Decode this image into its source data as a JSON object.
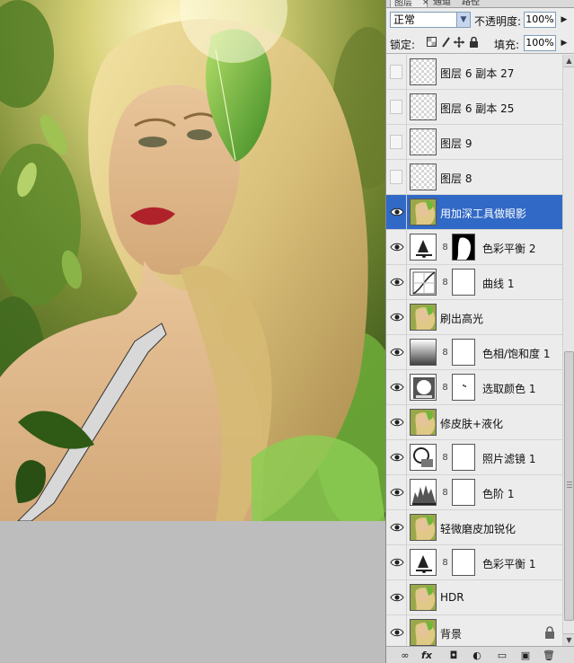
{
  "panel": {
    "tabs": [
      {
        "label": "图层",
        "active": true
      },
      {
        "label": "通道",
        "active": false
      },
      {
        "label": "路径",
        "active": false
      }
    ],
    "tab_close": "×",
    "blend_mode": "正常",
    "opacity_label": "不透明度:",
    "opacity_value": "100%",
    "lock_label": "锁定:",
    "fill_label": "填充:",
    "fill_value": "100%",
    "dropdown_arrow": "▼",
    "spin_arrow": "▶"
  },
  "layers": [
    {
      "name": "图层 6 副本 27",
      "visible": false,
      "type": "empty",
      "selected": false
    },
    {
      "name": "图层 6 副本 25",
      "visible": false,
      "type": "empty",
      "selected": false
    },
    {
      "name": "图层 9",
      "visible": false,
      "type": "empty",
      "selected": false
    },
    {
      "name": "图层 8",
      "visible": false,
      "type": "empty-soft",
      "selected": false
    },
    {
      "name": "用加深工具做眼影",
      "visible": true,
      "type": "photo",
      "selected": true
    },
    {
      "name": "色彩平衡 2",
      "visible": true,
      "type": "color-balance",
      "mask": "figure",
      "selected": false
    },
    {
      "name": "曲线 1",
      "visible": true,
      "type": "curves",
      "mask": "white",
      "selected": false
    },
    {
      "name": "刷出高光",
      "visible": true,
      "type": "photo",
      "selected": false
    },
    {
      "name": "色相/饱和度 1",
      "visible": true,
      "type": "hue-saturation",
      "mask": "white",
      "selected": false
    },
    {
      "name": "选取颜色 1",
      "visible": true,
      "type": "selective-color",
      "mask": "dots",
      "selected": false
    },
    {
      "name": "修皮肤+液化",
      "visible": true,
      "type": "photo",
      "selected": false
    },
    {
      "name": "照片滤镜 1",
      "visible": true,
      "type": "photo-filter",
      "mask": "white",
      "selected": false
    },
    {
      "name": "色阶 1",
      "visible": true,
      "type": "levels",
      "mask": "white",
      "selected": false
    },
    {
      "name": "轻微磨皮加锐化",
      "visible": true,
      "type": "photo",
      "selected": false
    },
    {
      "name": "色彩平衡 1",
      "visible": true,
      "type": "color-balance",
      "mask": "white",
      "selected": false
    },
    {
      "name": "HDR",
      "visible": true,
      "type": "photo",
      "selected": false
    },
    {
      "name": "背景",
      "visible": true,
      "type": "photo",
      "selected": false,
      "locked": true
    }
  ],
  "bottom_bar": {
    "link_icon": "∞",
    "fx_icon": "fx",
    "mask_icon": "◘",
    "adjust_icon": "◐",
    "group_icon": "▭",
    "new_icon": "▣",
    "delete_icon": "🗑"
  },
  "scroll": {
    "up": "▲",
    "down": "▼"
  },
  "colors": {
    "selected_row": "#3169c6",
    "panel_bg": "#ececec",
    "canvas_bg": "#bdbdbd"
  }
}
